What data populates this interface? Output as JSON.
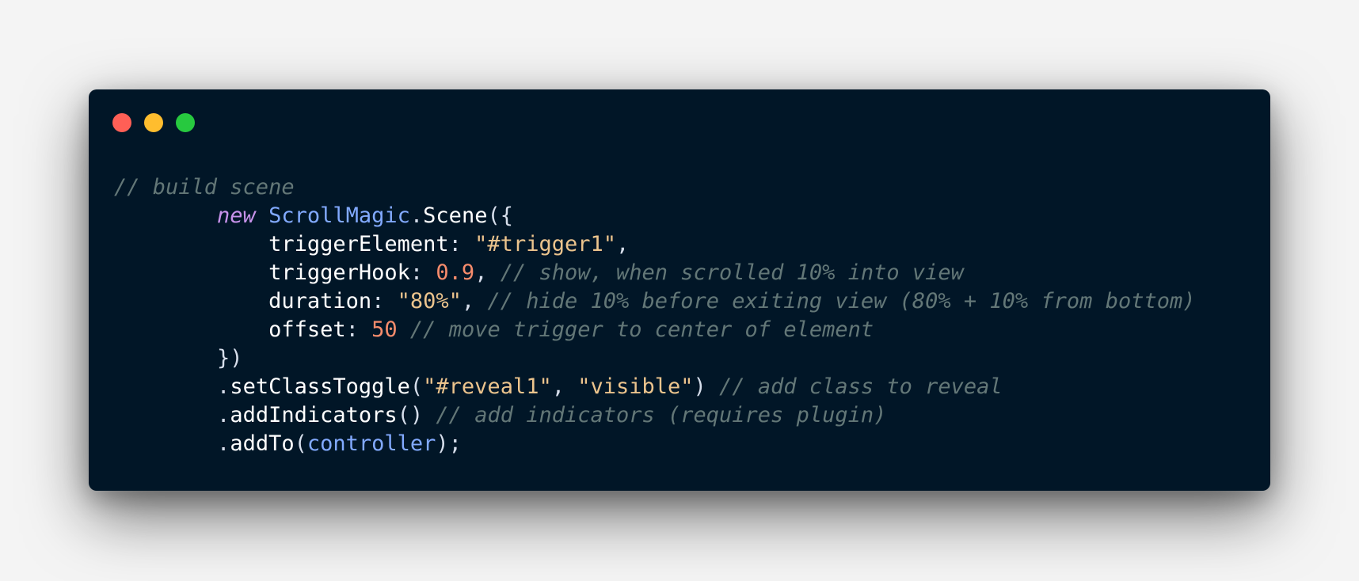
{
  "colors": {
    "page_background": "#f4f4f4",
    "window_background": "#011627",
    "close": "#ff5f56",
    "minimize": "#ffbd2e",
    "zoom": "#27c93f",
    "comment": "#637777",
    "keyword": "#c792ea",
    "class": "#82aaff",
    "string": "#ecc48d",
    "number": "#f78c6c",
    "text": "#d6deeb"
  },
  "window_controls": [
    {
      "name": "close-button",
      "color": "#ff5f56"
    },
    {
      "name": "minimize-button",
      "color": "#ffbd2e"
    },
    {
      "name": "zoom-button",
      "color": "#27c93f"
    }
  ],
  "code": {
    "lines": [
      [
        {
          "t": "// build scene",
          "k": "comment"
        }
      ],
      [
        {
          "t": "        ",
          "k": "punct"
        },
        {
          "t": "new",
          "k": "keyword"
        },
        {
          "t": " ",
          "k": "punct"
        },
        {
          "t": "ScrollMagic",
          "k": "class"
        },
        {
          "t": ".",
          "k": "punct"
        },
        {
          "t": "Scene",
          "k": "prop"
        },
        {
          "t": "({",
          "k": "punct"
        }
      ],
      [
        {
          "t": "            ",
          "k": "punct"
        },
        {
          "t": "triggerElement",
          "k": "prop"
        },
        {
          "t": ": ",
          "k": "punct"
        },
        {
          "t": "\"#trigger1\"",
          "k": "string"
        },
        {
          "t": ",",
          "k": "punct"
        }
      ],
      [
        {
          "t": "            ",
          "k": "punct"
        },
        {
          "t": "triggerHook",
          "k": "prop"
        },
        {
          "t": ": ",
          "k": "punct"
        },
        {
          "t": "0.9",
          "k": "number"
        },
        {
          "t": ", ",
          "k": "punct"
        },
        {
          "t": "// show, when scrolled 10% into view",
          "k": "comment"
        }
      ],
      [
        {
          "t": "            ",
          "k": "punct"
        },
        {
          "t": "duration",
          "k": "prop"
        },
        {
          "t": ": ",
          "k": "punct"
        },
        {
          "t": "\"80%\"",
          "k": "string"
        },
        {
          "t": ", ",
          "k": "punct"
        },
        {
          "t": "// hide 10% before exiting view (80% + 10% from bottom)",
          "k": "comment"
        }
      ],
      [
        {
          "t": "            ",
          "k": "punct"
        },
        {
          "t": "offset",
          "k": "prop"
        },
        {
          "t": ": ",
          "k": "punct"
        },
        {
          "t": "50",
          "k": "number"
        },
        {
          "t": " ",
          "k": "punct"
        },
        {
          "t": "// move trigger to center of element",
          "k": "comment"
        }
      ],
      [
        {
          "t": "        ",
          "k": "punct"
        },
        {
          "t": "})",
          "k": "punct"
        }
      ],
      [
        {
          "t": "        ",
          "k": "punct"
        },
        {
          "t": ".",
          "k": "punct"
        },
        {
          "t": "setClassToggle",
          "k": "method"
        },
        {
          "t": "(",
          "k": "punct"
        },
        {
          "t": "\"#reveal1\"",
          "k": "string"
        },
        {
          "t": ", ",
          "k": "punct"
        },
        {
          "t": "\"visible\"",
          "k": "string"
        },
        {
          "t": ") ",
          "k": "punct"
        },
        {
          "t": "// add class to reveal",
          "k": "comment"
        }
      ],
      [
        {
          "t": "        ",
          "k": "punct"
        },
        {
          "t": ".",
          "k": "punct"
        },
        {
          "t": "addIndicators",
          "k": "method"
        },
        {
          "t": "() ",
          "k": "punct"
        },
        {
          "t": "// add indicators (requires plugin)",
          "k": "comment"
        }
      ],
      [
        {
          "t": "        ",
          "k": "punct"
        },
        {
          "t": ".",
          "k": "punct"
        },
        {
          "t": "addTo",
          "k": "method"
        },
        {
          "t": "(",
          "k": "punct"
        },
        {
          "t": "controller",
          "k": "var"
        },
        {
          "t": ");",
          "k": "punct"
        }
      ]
    ]
  }
}
